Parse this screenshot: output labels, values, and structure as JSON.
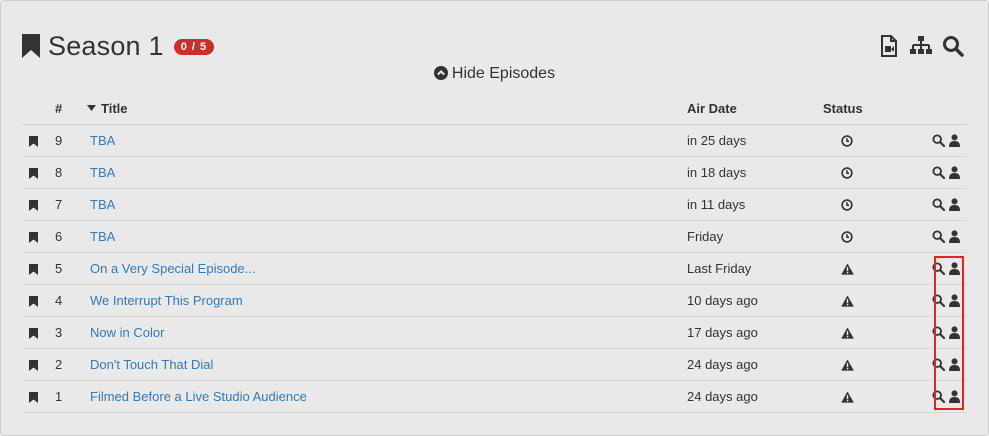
{
  "season": {
    "title": "Season 1",
    "badge": "0 / 5",
    "toggle_label": "Hide Episodes",
    "icons": [
      "video-file-icon",
      "sitemap-icon",
      "search-icon"
    ]
  },
  "table": {
    "columns": {
      "number": "#",
      "title": "Title",
      "air_date": "Air Date",
      "status": "Status"
    },
    "episodes": [
      {
        "number": "9",
        "title": "TBA",
        "air_date": "in 25 days",
        "status_icon": "clock-icon"
      },
      {
        "number": "8",
        "title": "TBA",
        "air_date": "in 18 days",
        "status_icon": "clock-icon"
      },
      {
        "number": "7",
        "title": "TBA",
        "air_date": "in 11 days",
        "status_icon": "clock-icon"
      },
      {
        "number": "6",
        "title": "TBA",
        "air_date": "Friday",
        "status_icon": "clock-icon"
      },
      {
        "number": "5",
        "title": "On a Very Special Episode...",
        "air_date": "Last Friday",
        "status_icon": "warning-icon"
      },
      {
        "number": "4",
        "title": "We Interrupt This Program",
        "air_date": "10 days ago",
        "status_icon": "warning-icon"
      },
      {
        "number": "3",
        "title": "Now in Color",
        "air_date": "17 days ago",
        "status_icon": "warning-icon"
      },
      {
        "number": "2",
        "title": "Don't Touch That Dial",
        "air_date": "24 days ago",
        "status_icon": "warning-icon"
      },
      {
        "number": "1",
        "title": "Filmed Before a Live Studio Audience",
        "air_date": "24 days ago",
        "status_icon": "warning-icon"
      }
    ]
  },
  "colors": {
    "panel_bg": "#e9e9e9",
    "link": "#337ab7",
    "badge": "#c9302c",
    "highlight": "#e8231b"
  }
}
